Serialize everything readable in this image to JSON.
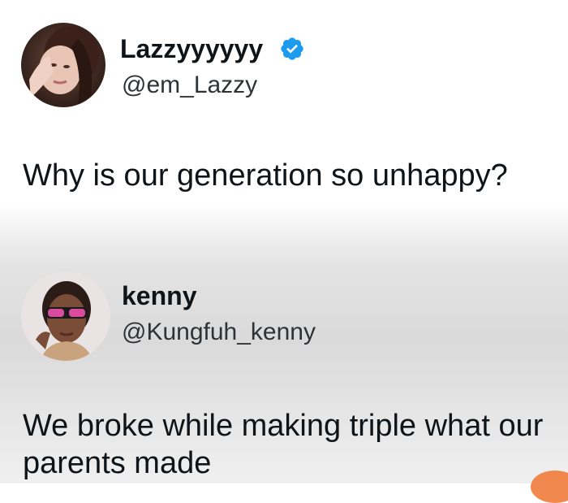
{
  "posts": [
    {
      "author": {
        "display_name": "Lazzyyyyyy",
        "handle": "@em_Lazzy",
        "verified": true,
        "avatar_icon": "profile-photo-woman"
      },
      "text": "Why is our generation so unhappy?"
    },
    {
      "author": {
        "display_name": "kenny",
        "handle": "@Kungfuh_kenny",
        "verified": false,
        "avatar_icon": "profile-photo-person-sunglasses"
      },
      "text_lines": [
        "We broke while making triple what our",
        "parents made"
      ]
    }
  ],
  "colors": {
    "verified_badge": "#1d9bf0",
    "text": "#0f1419",
    "handle": "#2e3338",
    "corner_accent": "#ef7b3a"
  }
}
